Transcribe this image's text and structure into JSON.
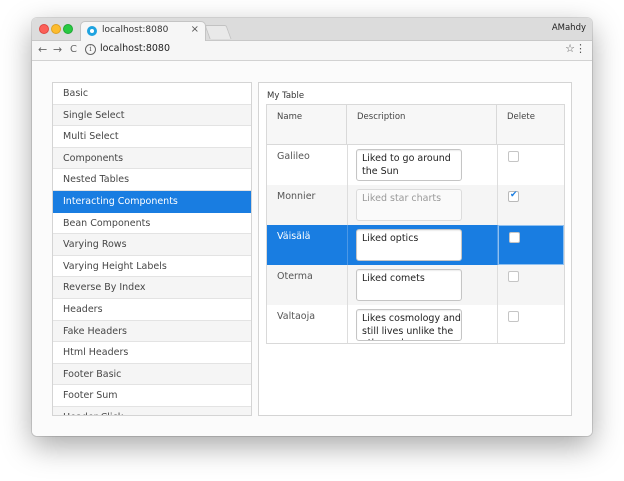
{
  "browser": {
    "tab_title": "localhost:8080",
    "tab_close": "×",
    "profile_name": "AMahdy",
    "url": "localhost:8080",
    "nav": {
      "back": "←",
      "forward": "→",
      "reload": "C"
    },
    "info_glyph": "i",
    "star_glyph": "☆",
    "menu_glyph": "⋮"
  },
  "sidebar": {
    "items": [
      {
        "label": "Basic"
      },
      {
        "label": "Single Select"
      },
      {
        "label": "Multi Select"
      },
      {
        "label": "Components"
      },
      {
        "label": "Nested Tables"
      },
      {
        "label": "Interacting Components"
      },
      {
        "label": "Bean Components"
      },
      {
        "label": "Varying Rows"
      },
      {
        "label": "Varying Height Labels"
      },
      {
        "label": "Reverse By Index"
      },
      {
        "label": "Headers"
      },
      {
        "label": "Fake Headers"
      },
      {
        "label": "Html Headers"
      },
      {
        "label": "Footer Basic"
      },
      {
        "label": "Footer Sum"
      },
      {
        "label": "Header Click"
      }
    ],
    "selected_index": 5
  },
  "table": {
    "caption": "My Table",
    "columns": [
      "Name",
      "Description",
      "Delete"
    ],
    "rows": [
      {
        "name": "Galileo",
        "description": "Liked to go around the Sun",
        "delete": false
      },
      {
        "name": "Monnier",
        "description": "Liked star charts",
        "delete": true
      },
      {
        "name": "Väisälä",
        "description": "Liked optics",
        "delete": false
      },
      {
        "name": "Oterma",
        "description": "Liked comets",
        "delete": false
      },
      {
        "name": "Valtaoja",
        "description": "Likes cosmology and still lives unlike the others above",
        "delete": false
      }
    ],
    "selected_row": 2,
    "readonly_row": 1
  },
  "colors": {
    "accent": "#197de1",
    "close_light": "#fc5f57",
    "minimize_light": "#fdbc2e",
    "zoom_light": "#28c941"
  },
  "icons": {
    "tab": "globe-icon",
    "info": "info-icon",
    "bookmark": "star-icon",
    "menu": "kebab-menu-icon",
    "check": "checkmark-icon"
  }
}
